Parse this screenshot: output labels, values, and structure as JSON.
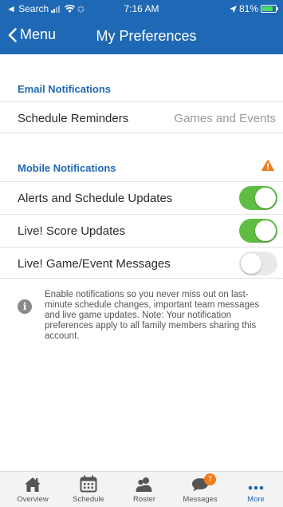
{
  "status_bar": {
    "back_app": "◄ Search",
    "time": "7:16 AM",
    "battery": "81%",
    "battery_level": 0.81
  },
  "nav": {
    "back_label": "Menu",
    "title": "My Preferences"
  },
  "email_section": {
    "header": "Email Notifications",
    "rows": [
      {
        "label": "Schedule Reminders",
        "value": "Games and Events"
      }
    ]
  },
  "mobile_section": {
    "header": "Mobile Notifications",
    "warning_color": "#f07c1d",
    "rows": [
      {
        "label": "Alerts and Schedule Updates",
        "enabled": true
      },
      {
        "label": "Live! Score Updates",
        "enabled": true
      },
      {
        "label": "Live! Game/Event Messages",
        "enabled": false
      }
    ]
  },
  "info": {
    "icon": "i",
    "text": "Enable notifications so you never miss out on last-minute schedule changes, important team messages and live game updates. Note: Your notification preferences apply to all family members sharing this account."
  },
  "tabs": [
    {
      "label": "Overview",
      "icon": "house-icon"
    },
    {
      "label": "Schedule",
      "icon": "calendar-icon"
    },
    {
      "label": "Roster",
      "icon": "people-icon"
    },
    {
      "label": "Messages",
      "icon": "chat-icon",
      "badge": "7"
    },
    {
      "label": "More",
      "icon": "more-dots-icon",
      "active": true
    }
  ],
  "colors": {
    "brand": "#1f68b5",
    "toggle_on": "#5fbd43",
    "toggle_off": "#e9e9ea",
    "badge": "#f07c1d"
  }
}
